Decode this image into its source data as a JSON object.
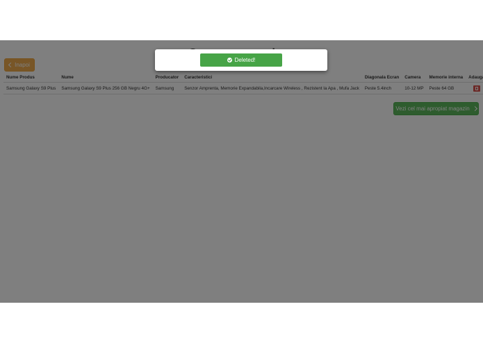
{
  "page": {
    "title": "Comparare produse"
  },
  "back_button": {
    "label": "Inapoi"
  },
  "table": {
    "headers": [
      "Nume Produs",
      "Nume",
      "Producator",
      "Caracteristici",
      "Diagonala Ecran",
      "Camera",
      "Memorie interna",
      "Adauga"
    ],
    "rows": [
      {
        "nume_produs": "Samsung Galaxy S9 Plus",
        "nume": "Samsung Galaxy S9 Plus 256 GB Negru 4G+",
        "producator": "Samsung",
        "caracteristici": "Senzor Amprenta, Memorie Expandabila,Incarcare Wireless , Rezistent la Apa , Mufa Jack",
        "diagonala": "Peste 5.4inch",
        "camera": "10-12 MP",
        "memorie": "Peste 64 GB",
        "action_icon": "trash-icon"
      }
    ]
  },
  "store_button": {
    "label": "Vezi cel mai apropiat magazin"
  },
  "toast": {
    "message": "Deleted!",
    "icon": "check-circle-icon"
  },
  "colors": {
    "warning": "#f0ad4e",
    "success": "#5cb85c",
    "danger": "#d9534f",
    "overlay": "rgba(0,0,0,0.5)"
  }
}
